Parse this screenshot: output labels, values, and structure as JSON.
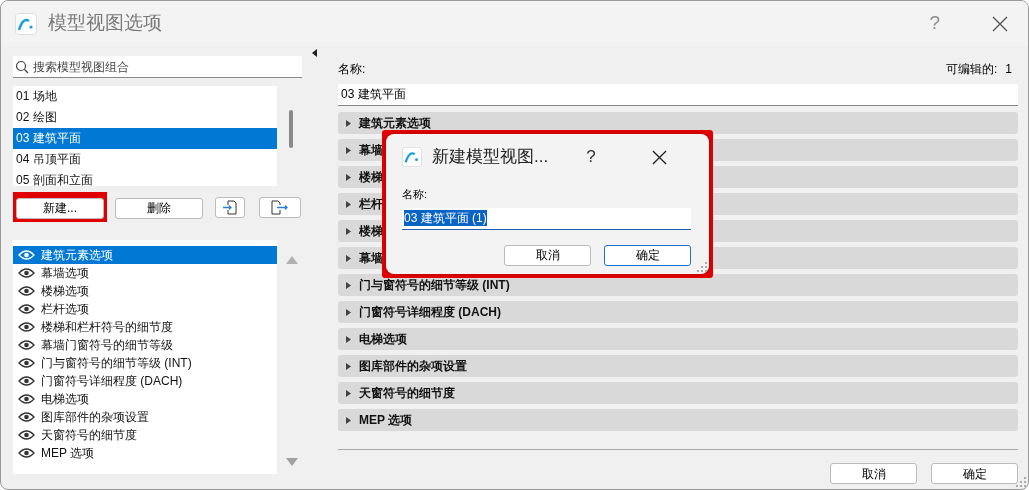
{
  "window": {
    "title": "模型视图选项",
    "help": "?"
  },
  "search": {
    "placeholder": "搜索模型视图组合"
  },
  "views": [
    {
      "label": "01 场地",
      "selected": false
    },
    {
      "label": "02 绘图",
      "selected": false
    },
    {
      "label": "03 建筑平面",
      "selected": true
    },
    {
      "label": "04 吊顶平面",
      "selected": false
    },
    {
      "label": "05 剖面和立面",
      "selected": false
    }
  ],
  "view_buttons": [
    {
      "label": "新建...",
      "highlighted": true
    },
    {
      "label": "删除",
      "highlighted": false
    }
  ],
  "layers": [
    {
      "label": "建筑元素选项",
      "selected": true
    },
    {
      "label": "幕墙选项",
      "selected": false
    },
    {
      "label": "楼梯选项",
      "selected": false
    },
    {
      "label": "栏杆选项",
      "selected": false
    },
    {
      "label": "楼梯和栏杆符号的细节度",
      "selected": false
    },
    {
      "label": "幕墙门窗符号的细节等级",
      "selected": false
    },
    {
      "label": "门与窗符号的细节等级 (INT)",
      "selected": false
    },
    {
      "label": "门窗符号详细程度 (DACH)",
      "selected": false
    },
    {
      "label": "电梯选项",
      "selected": false
    },
    {
      "label": "图库部件的杂项设置",
      "selected": false
    },
    {
      "label": "天窗符号的细节度",
      "selected": false
    },
    {
      "label": "MEP 选项",
      "selected": false
    }
  ],
  "name_label": "名称:",
  "editable_label": "可编辑的:",
  "editable_count": "1",
  "name_value": "03 建筑平面",
  "sections": [
    {
      "label": "建筑元素选项",
      "expanded": false
    },
    {
      "label": "幕墙",
      "expanded": false
    },
    {
      "label": "楼梯",
      "expanded": false
    },
    {
      "label": "栏杆",
      "expanded": false
    },
    {
      "label": "楼梯",
      "expanded": false
    },
    {
      "label": "幕墙",
      "expanded": false
    },
    {
      "label": "门与窗符号的细节等级 (INT)",
      "expanded": false
    },
    {
      "label": "门窗符号详细程度 (DACH)",
      "expanded": false
    },
    {
      "label": "电梯选项",
      "expanded": false
    },
    {
      "label": "图库部件的杂项设置",
      "expanded": false
    },
    {
      "label": "天窗符号的细节度",
      "expanded": false
    },
    {
      "label": "MEP 选项",
      "expanded": false
    }
  ],
  "buttons": [
    {
      "label": "取消",
      "default": false
    },
    {
      "label": "确定",
      "default": false
    }
  ],
  "dialog": {
    "title": "新建模型视图...",
    "help": "?",
    "name_label": "名称:",
    "name_value": "03 建筑平面 (1)",
    "highlighted": true,
    "buttons": [
      {
        "label": "取消",
        "default": false
      },
      {
        "label": "确定",
        "default": true
      }
    ]
  }
}
